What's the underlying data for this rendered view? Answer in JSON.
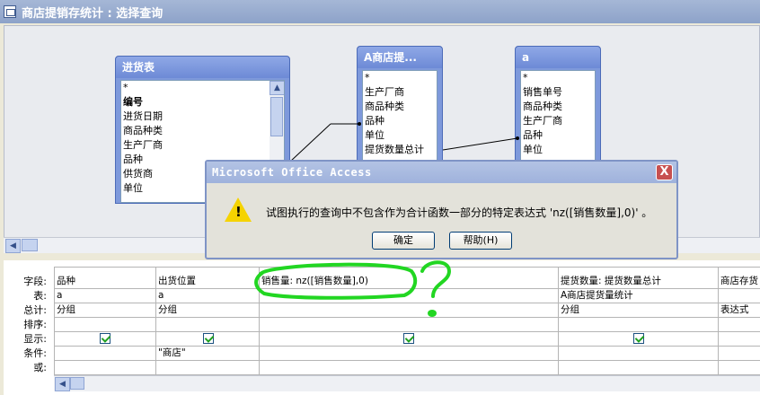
{
  "window": {
    "title": "商店提销存统计 : 选择查询"
  },
  "tables": [
    {
      "name": "进货表",
      "fields": [
        "*",
        "编号",
        "进货日期",
        "商品种类",
        "生产厂商",
        "品种",
        "供货商",
        "单位"
      ]
    },
    {
      "name": "A商店提...",
      "fields": [
        "*",
        "生产厂商",
        "商品种类",
        "品种",
        "单位",
        "提货数量总计"
      ]
    },
    {
      "name": "a",
      "fields": [
        "*",
        "销售单号",
        "商品种类",
        "生产厂商",
        "品种",
        "单位"
      ]
    }
  ],
  "dialog": {
    "title": "Microsoft Office Access",
    "close_label": "X",
    "message": "试图执行的查询中不包含作为合计函数一部分的特定表达式 'nz([销售数量],0)' 。",
    "ok_label": "确定",
    "help_label": "帮助(H)"
  },
  "grid": {
    "row_labels": [
      "字段:",
      "表:",
      "总计:",
      "排序:",
      "显示:",
      "条件:",
      "或:"
    ],
    "columns": [
      {
        "field": "品种",
        "table": "a",
        "total": "分组",
        "sort": "",
        "show": true,
        "criteria": "",
        "or": ""
      },
      {
        "field": "出货位置",
        "table": "a",
        "total": "分组",
        "sort": "",
        "show": true,
        "criteria": "\"商店\"",
        "or": ""
      },
      {
        "field": "销售量: nz([销售数量],0)",
        "table": "",
        "total": "",
        "sort": "",
        "show": true,
        "criteria": "",
        "or": ""
      },
      {
        "field": "提货数量: 提货数量总计",
        "table": "A商店提货量统计",
        "total": "分组",
        "sort": "",
        "show": true,
        "criteria": "",
        "or": ""
      },
      {
        "field": "商店存货",
        "table": "",
        "total": "表达式",
        "sort": "",
        "show": false,
        "criteria": "",
        "or": ""
      }
    ]
  },
  "annotation": {
    "mark": "?",
    "color": "#22d622"
  }
}
